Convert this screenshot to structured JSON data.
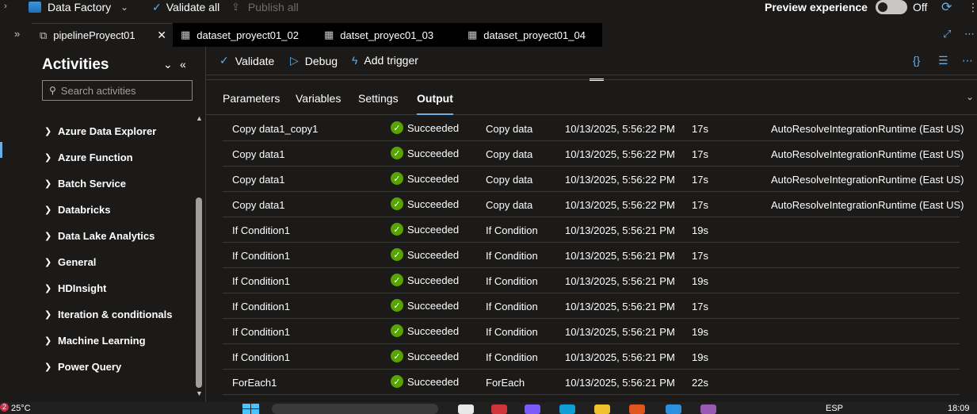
{
  "topbar": {
    "factory_label": "Data Factory",
    "validate_all": "Validate all",
    "publish_all": "Publish all",
    "preview_label": "Preview experience",
    "toggle_state": "Off"
  },
  "tabs": [
    {
      "label": "pipelineProyect01",
      "active": true
    },
    {
      "label": "dataset_proyect01_02",
      "active": false
    },
    {
      "label": "datset_proyec01_03",
      "active": false
    },
    {
      "label": "dataset_proyect01_04",
      "active": false
    }
  ],
  "activities": {
    "title": "Activities",
    "search_placeholder": "Search activities",
    "items": [
      {
        "label": "Azure Data Explorer"
      },
      {
        "label": "Azure Function"
      },
      {
        "label": "Batch Service"
      },
      {
        "label": "Databricks"
      },
      {
        "label": "Data Lake Analytics"
      },
      {
        "label": "General"
      },
      {
        "label": "HDInsight"
      },
      {
        "label": "Iteration & conditionals"
      },
      {
        "label": "Machine Learning"
      },
      {
        "label": "Power Query"
      }
    ]
  },
  "toolbar": {
    "validate": "Validate",
    "debug": "Debug",
    "add_trigger": "Add trigger"
  },
  "bottom_tabs": [
    {
      "label": "Parameters",
      "selected": false
    },
    {
      "label": "Variables",
      "selected": false
    },
    {
      "label": "Settings",
      "selected": false
    },
    {
      "label": "Output",
      "selected": true
    }
  ],
  "output": {
    "rows": [
      {
        "name": "Copy data1_copy1",
        "status": "Succeeded",
        "type": "Copy data",
        "start": "10/13/2025, 5:56:22 PM",
        "duration": "17s",
        "ir": "AutoResolveIntegrationRuntime (East US)"
      },
      {
        "name": "Copy data1",
        "status": "Succeeded",
        "type": "Copy data",
        "start": "10/13/2025, 5:56:22 PM",
        "duration": "17s",
        "ir": "AutoResolveIntegrationRuntime (East US)"
      },
      {
        "name": "Copy data1",
        "status": "Succeeded",
        "type": "Copy data",
        "start": "10/13/2025, 5:56:22 PM",
        "duration": "17s",
        "ir": "AutoResolveIntegrationRuntime (East US)"
      },
      {
        "name": "Copy data1",
        "status": "Succeeded",
        "type": "Copy data",
        "start": "10/13/2025, 5:56:22 PM",
        "duration": "17s",
        "ir": "AutoResolveIntegrationRuntime (East US)"
      },
      {
        "name": "If Condition1",
        "status": "Succeeded",
        "type": "If Condition",
        "start": "10/13/2025, 5:56:21 PM",
        "duration": "19s",
        "ir": ""
      },
      {
        "name": "If Condition1",
        "status": "Succeeded",
        "type": "If Condition",
        "start": "10/13/2025, 5:56:21 PM",
        "duration": "17s",
        "ir": ""
      },
      {
        "name": "If Condition1",
        "status": "Succeeded",
        "type": "If Condition",
        "start": "10/13/2025, 5:56:21 PM",
        "duration": "19s",
        "ir": ""
      },
      {
        "name": "If Condition1",
        "status": "Succeeded",
        "type": "If Condition",
        "start": "10/13/2025, 5:56:21 PM",
        "duration": "17s",
        "ir": ""
      },
      {
        "name": "If Condition1",
        "status": "Succeeded",
        "type": "If Condition",
        "start": "10/13/2025, 5:56:21 PM",
        "duration": "19s",
        "ir": ""
      },
      {
        "name": "If Condition1",
        "status": "Succeeded",
        "type": "If Condition",
        "start": "10/13/2025, 5:56:21 PM",
        "duration": "19s",
        "ir": ""
      },
      {
        "name": "ForEach1",
        "status": "Succeeded",
        "type": "ForEach",
        "start": "10/13/2025, 5:56:21 PM",
        "duration": "22s",
        "ir": ""
      }
    ]
  },
  "taskbar": {
    "badge": "2",
    "temperature": "25°C",
    "language": "ESP",
    "clock": "18:09"
  },
  "colors": {
    "accent": "#69afe5",
    "success": "#57a300",
    "background": "#1b1a19"
  }
}
